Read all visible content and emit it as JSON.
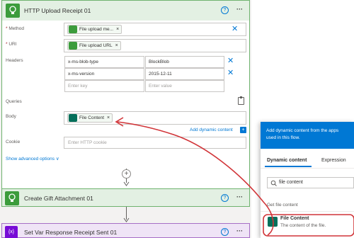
{
  "card": {
    "title": "HTTP Upload Receipt 01",
    "help": "?",
    "more": "···"
  },
  "fields": {
    "method_label": "Method",
    "method_token": "File upload me...",
    "uri_label": "URI",
    "uri_token": "File upload URL",
    "headers_label": "Headers",
    "queries_label": "Queries",
    "body_label": "Body",
    "body_token": "File Content",
    "cookie_label": "Cookie",
    "cookie_placeholder": "Enter HTTP cookie",
    "required_mark": "*",
    "token_close": "×",
    "remove": "✕"
  },
  "headers": [
    {
      "key": "x-ms-blob-type",
      "value": "BlockBlob"
    },
    {
      "key": "x-ms-version",
      "value": "2015-12-11"
    }
  ],
  "headers_placeholder": {
    "key": "Enter key",
    "value": "Enter value"
  },
  "links": {
    "add_dynamic": "Add dynamic content",
    "add_dynamic_plus": "+",
    "show_advanced": "Show advanced options",
    "chevron": "∨"
  },
  "connector": {
    "plus": "+"
  },
  "steps": [
    {
      "title": "Create Gift Attachment 01",
      "help": "?",
      "more": "···"
    },
    {
      "title": "Set Var Response Receipt Sent 01",
      "icon_text": "{x}",
      "help": "?",
      "more": "···"
    }
  ],
  "dynamic_panel": {
    "header": "Add dynamic content from the apps used in this flow.",
    "tabs": [
      "Dynamic content",
      "Expression"
    ],
    "search_value": "file content",
    "section": "Get file content",
    "item_title": "File Content",
    "item_desc": "The content of the file."
  },
  "colors": {
    "accent": "#0078d4",
    "green": "#3c9c3c",
    "teal": "#05705b",
    "arrow": "#d13438"
  },
  "icons": [
    "bulb-icon",
    "help-icon",
    "more-icon",
    "close-icon",
    "clipboard-icon",
    "search-icon",
    "variable-icon"
  ]
}
